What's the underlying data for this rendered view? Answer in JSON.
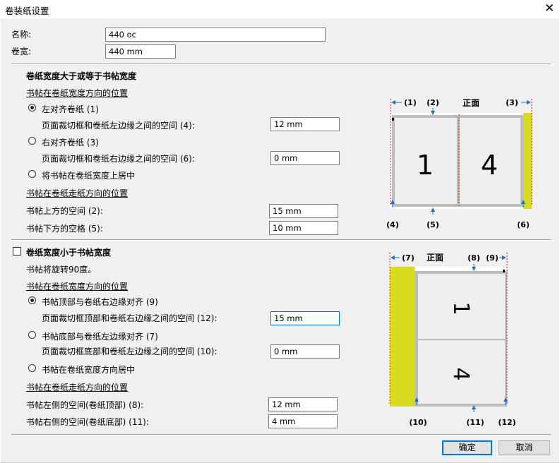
{
  "window": {
    "title": "卷装纸设置",
    "close_glyph": "✕"
  },
  "name": {
    "label": "名称:",
    "value": "440 oc"
  },
  "width": {
    "label": "卷宽:",
    "value": "440 mm"
  },
  "section1": {
    "title": "卷纸宽度大于或等于书帖宽度",
    "position_heading": "书帖在卷纸宽度方向的位置",
    "opt_left": "左对齐卷纸 (1)",
    "left_space_label": "页面裁切框和卷纸左边缘之间的空间 (4):",
    "left_space_value": "12 mm",
    "opt_right": "右对齐卷纸 (3)",
    "right_space_label": "页面裁切框和卷纸右边缘之间的空间 (6):",
    "right_space_value": "0 mm",
    "opt_center": "将书帖在卷纸宽度上居中",
    "feed_heading": "书帖在卷纸走纸方向的位置",
    "top_label": "书帖上方的空间 (2):",
    "top_value": "15 mm",
    "bottom_label": "书帖下方的空格 (5):",
    "bottom_value": "10 mm",
    "selected": "left",
    "diagram": {
      "front_label": "正面",
      "callouts": [
        "(1)",
        "(2)",
        "(3)",
        "(4)",
        "(5)",
        "(6)"
      ],
      "pages": [
        "1",
        "4"
      ]
    }
  },
  "section2": {
    "title": "卷纸宽度小于书帖宽度",
    "checked": false,
    "note": "书帖将旋转90度。",
    "position_heading": "书帖在卷纸宽度方向的位置",
    "opt_top": "书帖顶部与卷纸右边缘对齐 (9)",
    "top_space_label": "页面裁切框顶部和卷纸右边缘之间的空间 (12):",
    "top_space_value": "15 mm",
    "opt_bottom": "书帖底部与卷纸左边缘对齐 (7)",
    "bottom_space_label": "页面裁切框底部和卷纸左边缘之间的空间 (10):",
    "bottom_space_value": "0 mm",
    "opt_center": "书帖在卷纸宽度方向居中",
    "feed_heading": "书帖在卷纸走纸方向的位置",
    "left_label": "书帖左侧的空间(卷纸顶部) (8):",
    "left_value": "12 mm",
    "right_label": "书帖右侧的空间(卷纸底部) (11):",
    "right_value": "4 mm",
    "selected": "top",
    "diagram": {
      "front_label": "正面",
      "callouts": [
        "(7)",
        "(8)",
        "(9)",
        "(10)",
        "(11)",
        "(12)"
      ],
      "pages": [
        "1",
        "4"
      ]
    }
  },
  "buttons": {
    "ok": "确定",
    "cancel": "取消"
  },
  "colors": {
    "roll_yellow": "#d8dc1f",
    "accent": "#0078d7",
    "guide_red": "#e02020"
  }
}
